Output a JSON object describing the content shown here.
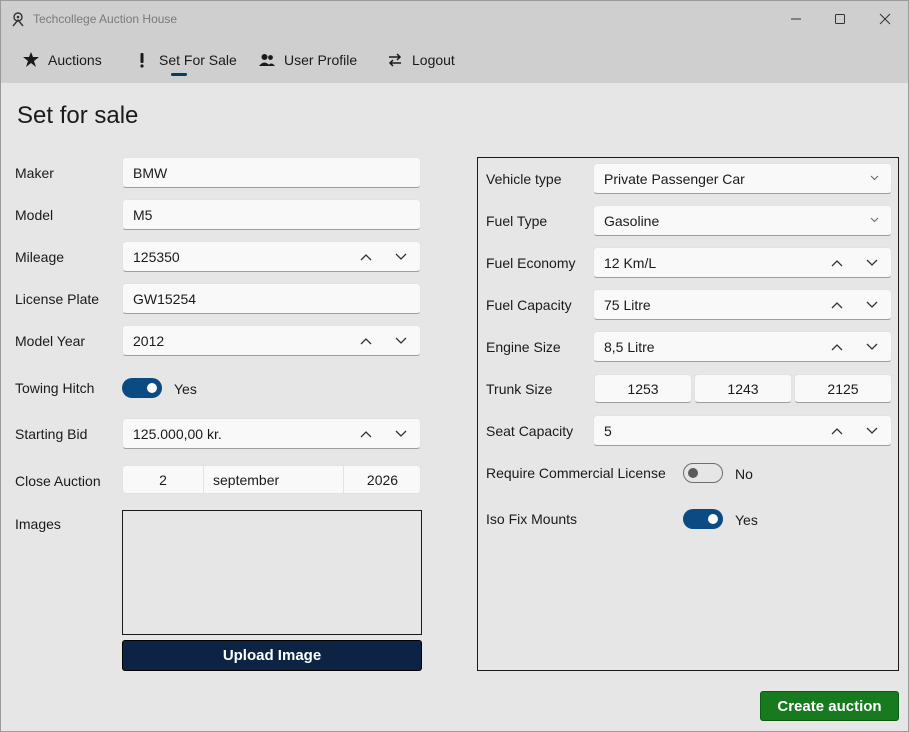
{
  "window": {
    "title": "Techcollege Auction House"
  },
  "nav": {
    "items": [
      {
        "label": "Auctions",
        "icon": "auction-icon"
      },
      {
        "label": "Set For Sale",
        "icon": "exclamation-icon",
        "active": true
      },
      {
        "label": "User Profile",
        "icon": "users-icon"
      },
      {
        "label": "Logout",
        "icon": "logout-icon"
      }
    ]
  },
  "page": {
    "title": "Set for sale"
  },
  "form": {
    "maker": {
      "label": "Maker",
      "value": "BMW"
    },
    "model": {
      "label": "Model",
      "value": "M5"
    },
    "mileage": {
      "label": "Mileage",
      "value": "125350"
    },
    "license_plate": {
      "label": "License Plate",
      "value": "GW15254"
    },
    "model_year": {
      "label": "Model Year",
      "value": "2012"
    },
    "towing_hitch": {
      "label": "Towing Hitch",
      "state_text": "Yes",
      "on": true
    },
    "starting_bid": {
      "label": "Starting Bid",
      "value": "125.000,00 kr."
    },
    "close_auction": {
      "label": "Close Auction",
      "day": "2",
      "month": "september",
      "year": "2026"
    },
    "images": {
      "label": "Images"
    },
    "upload_label": "Upload Image"
  },
  "vehicle": {
    "vehicle_type": {
      "label": "Vehicle type",
      "value": "Private Passenger Car"
    },
    "fuel_type": {
      "label": "Fuel Type",
      "value": "Gasoline"
    },
    "fuel_economy": {
      "label": "Fuel Economy",
      "value": "12 Km/L"
    },
    "fuel_capacity": {
      "label": "Fuel Capacity",
      "value": "75 Litre"
    },
    "engine_size": {
      "label": "Engine Size",
      "value": "8,5 Litre"
    },
    "trunk_size": {
      "label": "Trunk Size",
      "values": [
        "1253",
        "1243",
        "2125"
      ]
    },
    "seat_capacity": {
      "label": "Seat Capacity",
      "value": "5"
    },
    "commercial_license": {
      "label": "Require Commercial License",
      "state_text": "No",
      "on": false
    },
    "iso_fix": {
      "label": "Iso Fix Mounts",
      "state_text": "Yes",
      "on": true
    }
  },
  "actions": {
    "create_label": "Create auction"
  },
  "colors": {
    "accent": "#0b4a82",
    "upload_bg": "#0d2344",
    "create_bg": "#187a1f"
  }
}
